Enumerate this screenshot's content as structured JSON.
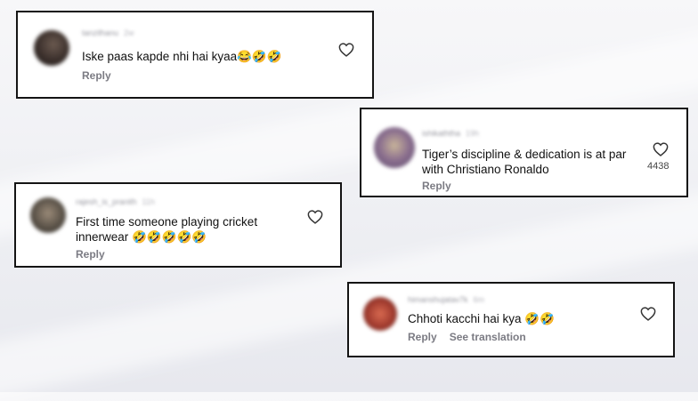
{
  "comments": [
    {
      "username": "tanzilhanu",
      "time": "2w",
      "text": "Iske paas kapde nhi hai kyaa😂🤣🤣",
      "reply_label": "Reply",
      "like_count": "",
      "avatar_color": "#3a2f2b"
    },
    {
      "username": "ishikaththa",
      "time": "19h",
      "text": "Tiger’s discipline & dedication is at par with Christiano Ronaldo",
      "reply_label": "Reply",
      "like_count": "4438",
      "avatar_color": "#8a6e8e"
    },
    {
      "username": "rajesh_is_pranith",
      "time": "11h",
      "text": "First time someone playing cricket innerwear 🤣🤣🤣🤣🤣",
      "reply_label": "Reply",
      "like_count": "",
      "avatar_color": "#5a5248"
    },
    {
      "username": "himanshujatav7k",
      "time": "6m",
      "text": "Chhoti kacchi hai kya 🤣🤣",
      "reply_label": "Reply",
      "translate_label": "See translation",
      "like_count": "",
      "avatar_color": "#a03a2e"
    }
  ],
  "colors": {
    "card_border": "#141414",
    "text": "#111111",
    "muted": "#7b7b83"
  },
  "icons": [
    "heart-icon"
  ]
}
